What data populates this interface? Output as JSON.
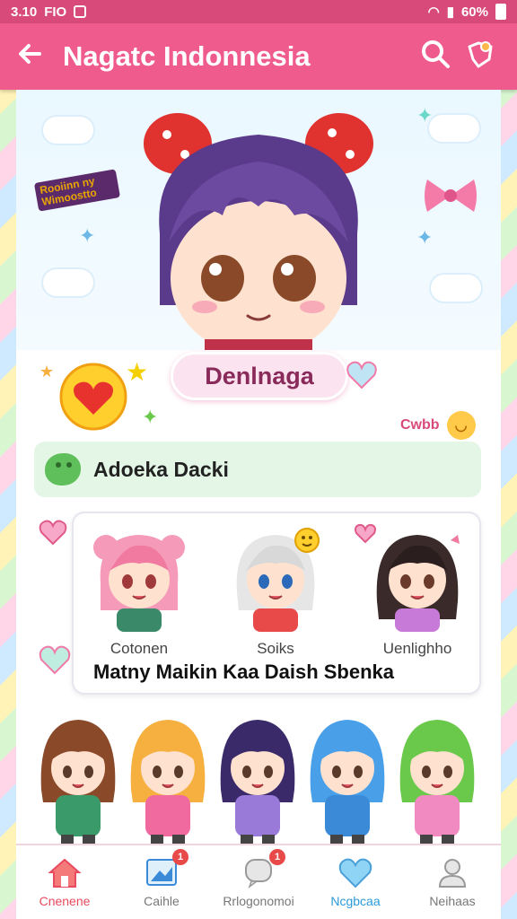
{
  "status_bar": {
    "time": "3.10",
    "carrier": "FIO",
    "battery": "60%"
  },
  "app_bar": {
    "title": "Nagatc Indonnesia"
  },
  "hero": {
    "sticker_text": "Rooiinn ny  Wimoostto"
  },
  "profile": {
    "name": "Denlnaga"
  },
  "cube_link": {
    "label": "Cwbb"
  },
  "green_card": {
    "text": "Adoeka Dacki"
  },
  "friends": {
    "items": [
      {
        "label": "Cotonen",
        "hair": "#f59ab8",
        "shirt": "#3a8a6a"
      },
      {
        "label": "Soiks",
        "hair": "#e6e6e6",
        "shirt": "#e84a4a"
      },
      {
        "label": "Uenlighho",
        "hair": "#3a2a2a",
        "shirt": "#c77ad8"
      }
    ],
    "title": "Matny Maikin Kaa Daish Sbenka"
  },
  "bottom_chibis": [
    {
      "hair": "#8a4a2a",
      "shirt": "#3a9a6a"
    },
    {
      "hair": "#f5b040",
      "shirt": "#f06aa0"
    },
    {
      "hair": "#3a2a6a",
      "shirt": "#9a7ad8"
    },
    {
      "hair": "#4aa0e8",
      "shirt": "#3a8ad8"
    },
    {
      "hair": "#6ac84a",
      "shirt": "#f08ac0"
    }
  ],
  "nav": {
    "items": [
      {
        "label": "Cnenene",
        "badge": ""
      },
      {
        "label": "Caihle",
        "badge": "1"
      },
      {
        "label": "Rrlogonomoi",
        "badge": "1"
      },
      {
        "label": "Ncgbcaa",
        "badge": ""
      },
      {
        "label": "Neihaas",
        "badge": ""
      }
    ]
  },
  "colors": {
    "primary": "#ef5b8c",
    "status": "#d84a7a",
    "active": "#e84a5f",
    "accent": "#2a9ad8"
  }
}
